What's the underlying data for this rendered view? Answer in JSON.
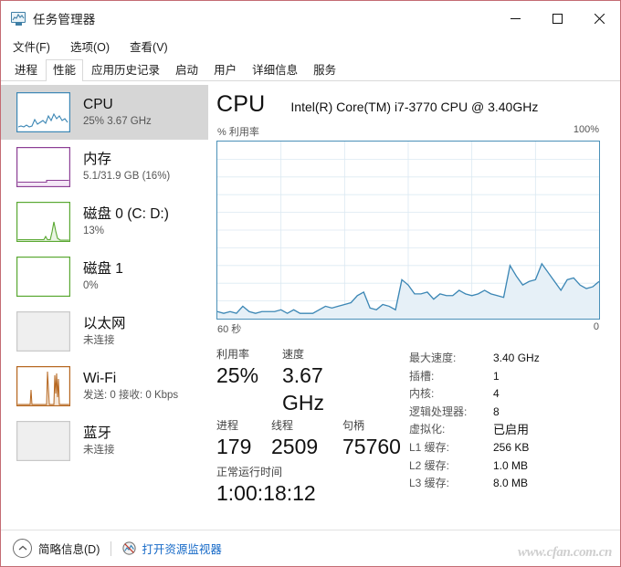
{
  "window": {
    "title": "任务管理器",
    "icon": "monitor-chart-icon",
    "minimize_label": "–",
    "maximize_label": "□",
    "close_label": "✕"
  },
  "menu": [
    {
      "label": "文件(F)"
    },
    {
      "label": "选项(O)"
    },
    {
      "label": "查看(V)"
    }
  ],
  "tabs": [
    {
      "label": "进程",
      "active": false
    },
    {
      "label": "性能",
      "active": true
    },
    {
      "label": "应用历史记录",
      "active": false
    },
    {
      "label": "启动",
      "active": false
    },
    {
      "label": "用户",
      "active": false
    },
    {
      "label": "详细信息",
      "active": false
    },
    {
      "label": "服务",
      "active": false
    }
  ],
  "sidebar": {
    "items": [
      {
        "name": "CPU",
        "sub": "25%  3.67 GHz",
        "selected": true,
        "color": "#3c87b5"
      },
      {
        "name": "内存",
        "sub": "5.1/31.9 GB (16%)",
        "selected": false,
        "color": "#8c3f95"
      },
      {
        "name": "磁盘 0 (C: D:)",
        "sub": "13%",
        "selected": false,
        "color": "#5aa832"
      },
      {
        "name": "磁盘 1",
        "sub": "0%",
        "selected": false,
        "color": "#5aa832"
      },
      {
        "name": "以太网",
        "sub": "未连接",
        "selected": false,
        "color": "#aaaaaa"
      },
      {
        "name": "Wi-Fi",
        "sub": "发送: 0  接收: 0 Kbps",
        "selected": false,
        "color": "#b5651d"
      },
      {
        "name": "蓝牙",
        "sub": "未连接",
        "selected": false,
        "color": "#aaaaaa"
      }
    ]
  },
  "main": {
    "title": "CPU",
    "model": "Intel(R) Core(TM) i7-3770 CPU @ 3.40GHz",
    "axis_top_left": "% 利用率",
    "axis_top_right": "100%",
    "axis_bottom_left": "60 秒",
    "axis_bottom_right": "0",
    "stats": {
      "utilization_label": "利用率",
      "utilization_value": "25%",
      "speed_label": "速度",
      "speed_value": "3.67 GHz",
      "processes_label": "进程",
      "processes_value": "179",
      "threads_label": "线程",
      "threads_value": "2509",
      "handles_label": "句柄",
      "handles_value": "75760",
      "uptime_label": "正常运行时间",
      "uptime_value": "1:00:18:12"
    },
    "specs": [
      {
        "key": "最大速度:",
        "value": "3.40 GHz"
      },
      {
        "key": "插槽:",
        "value": "1"
      },
      {
        "key": "内核:",
        "value": "4"
      },
      {
        "key": "逻辑处理器:",
        "value": "8"
      },
      {
        "key": "虚拟化:",
        "value": "已启用"
      },
      {
        "key": "L1 缓存:",
        "value": "256 KB"
      },
      {
        "key": "L2 缓存:",
        "value": "1.0 MB"
      },
      {
        "key": "L3 缓存:",
        "value": "8.0 MB"
      }
    ]
  },
  "statusbar": {
    "fewer_details_label": "简略信息(D)",
    "fewer_details_icon": "chevron-up-icon",
    "resource_monitor_label": "打开资源监视器",
    "resource_monitor_icon": "resource-monitor-icon"
  },
  "watermark": "www.cfan.com.cn",
  "colors": {
    "cpu_line": "#3c87b5",
    "cpu_fill": "#e6f0f7",
    "chart_border": "#4a90b8",
    "grid": "#dce9f2",
    "link": "#1569c7",
    "selection": "#d6d6d6",
    "window_border": "#c46b73"
  },
  "chart_data": {
    "type": "area",
    "title": "CPU 利用率",
    "xlabel": "60 秒",
    "ylabel": "% 利用率",
    "ylim": [
      0,
      100
    ],
    "xlim": [
      0,
      60
    ],
    "grid": true,
    "x_direction": "60 秒 (left) to 0 (right)",
    "series": [
      {
        "name": "CPU 利用率",
        "values": [
          4,
          3,
          4,
          3,
          7,
          4,
          3,
          4,
          4,
          4,
          5,
          3,
          5,
          3,
          3,
          3,
          5,
          7,
          6,
          7,
          8,
          9,
          13,
          15,
          6,
          5,
          8,
          7,
          5,
          22,
          19,
          14,
          14,
          15,
          11,
          14,
          13,
          13,
          16,
          14,
          13,
          14,
          16,
          14,
          13,
          12,
          30,
          24,
          19,
          21,
          22,
          31,
          26,
          21,
          16,
          22,
          23,
          19,
          17,
          18,
          21
        ]
      }
    ]
  }
}
